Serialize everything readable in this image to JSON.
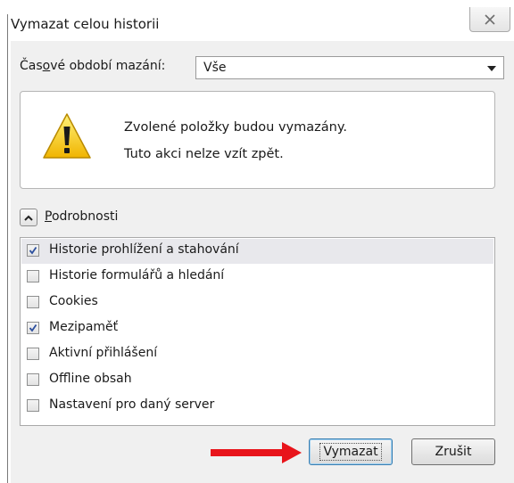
{
  "dialog": {
    "title": "Vymazat celou historii"
  },
  "period": {
    "label_before": "Čas",
    "label_accel": "o",
    "label_after": "vé období mazání:",
    "selected": "Vše"
  },
  "warning": {
    "line1": "Zvolené položky budou vymazány.",
    "line2": "Tuto akci nelze vzít zpět."
  },
  "details": {
    "label_accel": "P",
    "label_rest": "odrobnosti"
  },
  "items": [
    {
      "label": "Historie prohlížení a stahování",
      "checked": true
    },
    {
      "label": "Historie formulářů a hledání",
      "checked": false
    },
    {
      "label": "Cookies",
      "checked": false
    },
    {
      "label": "Mezipaměť",
      "checked": true
    },
    {
      "label": "Aktivní přihlášení",
      "checked": false
    },
    {
      "label": "Offline obsah",
      "checked": false
    },
    {
      "label": "Nastavení pro daný server",
      "checked": false
    }
  ],
  "buttons": {
    "clear": "Vymazat",
    "cancel": "Zrušit"
  },
  "colors": {
    "annotation_arrow": "#e8141b",
    "check": "#2c4f9e"
  }
}
